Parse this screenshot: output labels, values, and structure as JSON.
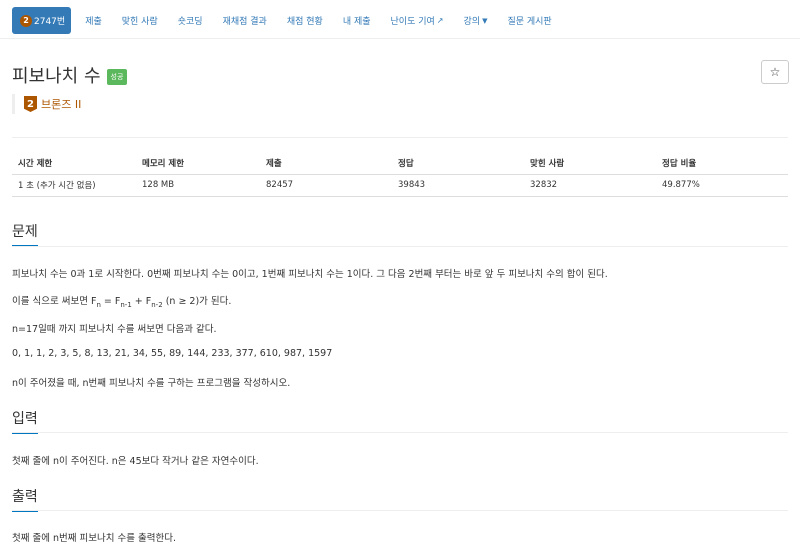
{
  "nav": {
    "problem_number": "2747번",
    "tier_number": "2",
    "items": [
      "제출",
      "맞힌 사람",
      "숏코딩",
      "재채점 결과",
      "채점 현황",
      "내 제출",
      "난이도 기여",
      "강의",
      "질문 게시판"
    ]
  },
  "problem": {
    "title": "피보나치 수",
    "badge": "성공",
    "star": "☆",
    "tier": {
      "number": "2",
      "label": "브론즈 II",
      "color": "#ad5600"
    }
  },
  "info_table": {
    "headers": [
      "시간 제한",
      "메모리 제한",
      "제출",
      "정답",
      "맞힌 사람",
      "정답 비율"
    ],
    "row": [
      "1 초 (추가 시간 없음)",
      "128 MB",
      "82457",
      "39843",
      "32832",
      "49.877%"
    ]
  },
  "sections": {
    "problem": {
      "heading": "문제",
      "p1": "피보나치 수는 0과 1로 시작한다. 0번째 피보나치 수는 0이고, 1번째 피보나치 수는 1이다. 그 다음 2번째 부터는 바로 앞 두 피보나치 수의 합이 된다.",
      "p2_prefix": "이를 식으로 써보면 F",
      "p2_sub1": "n",
      "p2_mid1": " = F",
      "p2_sub2": "n-1",
      "p2_mid2": " + F",
      "p2_sub3": "n-2",
      "p2_suffix": " (n ≥ 2)가 된다.",
      "p3": "n=17일때 까지 피보나치 수를 써보면 다음과 같다.",
      "p4": "0, 1, 1, 2, 3, 5, 8, 13, 21, 34, 55, 89, 144, 233, 377, 610, 987, 1597",
      "p5": "n이 주어졌을 때, n번째 피보나치 수를 구하는 프로그램을 작성하시오."
    },
    "input": {
      "heading": "입력",
      "p1": "첫째 줄에 n이 주어진다. n은 45보다 작거나 같은 자연수이다."
    },
    "output": {
      "heading": "출력",
      "p1": "첫째 줄에 n번째 피보나치 수를 출력한다."
    }
  },
  "colors": {
    "primary": "#337ab7",
    "success": "#5cb85c",
    "bronze": "#ad5600",
    "section_underline": "#0076c0"
  }
}
